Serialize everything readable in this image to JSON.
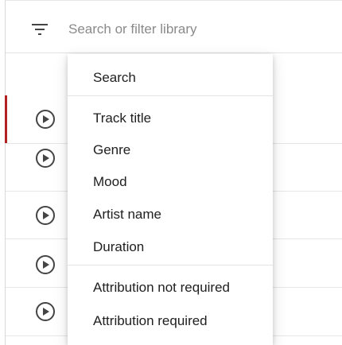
{
  "search": {
    "placeholder": "Search or filter library",
    "filter_icon": "filter-list-icon"
  },
  "track_rows": [
    {
      "play_icon": "play-circle-icon",
      "selected": true
    },
    {
      "play_icon": "play-circle-icon",
      "selected": false
    },
    {
      "play_icon": "play-circle-icon",
      "selected": false
    },
    {
      "play_icon": "play-circle-icon",
      "selected": false
    },
    {
      "play_icon": "play-circle-icon",
      "selected": false
    }
  ],
  "filter_menu": {
    "groups": [
      [
        "Search"
      ],
      [
        "Track title",
        "Genre",
        "Mood",
        "Artist name",
        "Duration"
      ],
      [
        "Attribution not required",
        "Attribution required"
      ]
    ]
  },
  "colors": {
    "selected_row_accent": "#b22222",
    "icon": "#444444",
    "placeholder": "#8a8a8a"
  }
}
